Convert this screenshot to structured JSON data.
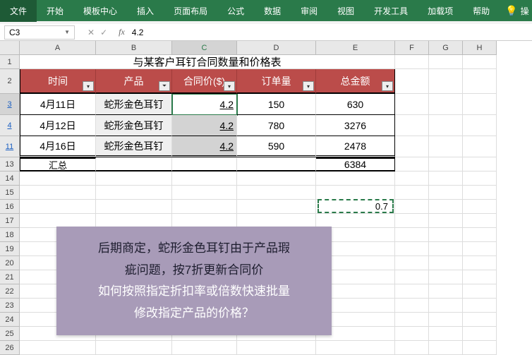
{
  "ribbon": {
    "tabs": [
      "文件",
      "开始",
      "模板中心",
      "插入",
      "页面布局",
      "公式",
      "数据",
      "审阅",
      "视图",
      "开发工具",
      "加载项",
      "帮助"
    ],
    "extra": "操"
  },
  "formula_bar": {
    "cell_ref": "C3",
    "fx": "fx",
    "value": "4.2"
  },
  "columns": [
    "A",
    "B",
    "C",
    "D",
    "E",
    "F",
    "G",
    "H"
  ],
  "row_nums": [
    "1",
    "2",
    "3",
    "4",
    "11",
    "13",
    "14",
    "15",
    "16",
    "17",
    "18",
    "19",
    "20",
    "21",
    "22",
    "23",
    "24",
    "25",
    "26"
  ],
  "title": "与某客户耳钉合同数量和价格表",
  "headers": {
    "time": "时间",
    "product": "产品",
    "price": "合同价($)",
    "qty": "订单量",
    "total": "总金额"
  },
  "table": {
    "rows": [
      {
        "date": "4月11日",
        "product": "蛇形金色耳钉",
        "price": "4.2",
        "qty": "150",
        "total": "630"
      },
      {
        "date": "4月12日",
        "product": "蛇形金色耳钉",
        "price": "4.2",
        "qty": "780",
        "total": "3276"
      },
      {
        "date": "4月16日",
        "product": "蛇形金色耳钉",
        "price": "4.2",
        "qty": "590",
        "total": "2478"
      }
    ],
    "summary_label": "汇总",
    "summary_total": "6384"
  },
  "dashed_value": "0.7",
  "callout": {
    "line1a": "后期商定，蛇形金色耳钉由于产品瑕",
    "line1b": "疵问题，按7折更新合同价",
    "line2a": "如何按照指定折扣率或倍数快速批量",
    "line2b": "修改指定产品的价格？"
  },
  "chart_data": {
    "type": "table",
    "title": "与某客户耳钉合同数量和价格表",
    "columns": [
      "时间",
      "产品",
      "合同价($)",
      "订单量",
      "总金额"
    ],
    "rows": [
      [
        "4月11日",
        "蛇形金色耳钉",
        4.2,
        150,
        630
      ],
      [
        "4月12日",
        "蛇形金色耳钉",
        4.2,
        780,
        3276
      ],
      [
        "4月16日",
        "蛇形金色耳钉",
        4.2,
        590,
        2478
      ]
    ],
    "summary": {
      "label": "汇总",
      "total": 6384
    },
    "discount_factor": 0.7
  }
}
